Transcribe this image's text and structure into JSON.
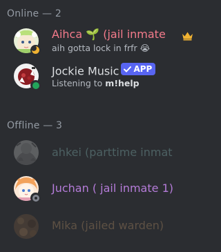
{
  "sections": {
    "online_header": "Online — 2",
    "offline_header": "Offline — 3"
  },
  "members": {
    "aihca": {
      "name": "Aihca 🌱 (jail inmate",
      "activity": "aih gotta lock in frfr 😭",
      "name_color": "#f47b8b",
      "status": "idle",
      "badge_icon": "crown-icon"
    },
    "jockie": {
      "name": "Jockie Music",
      "badge": "APP",
      "activity_prefix": "Listening to ",
      "activity_bold": "m!help",
      "name_color": "#dbdee1",
      "status": "online"
    },
    "ahkei": {
      "name": "ahkei (parttime inmat",
      "name_color": "#4d6163",
      "status": "offline"
    },
    "juchan": {
      "name": "Juchan ( jail inmate 1)",
      "name_color": "#b57cd9",
      "status": "offline"
    },
    "mika": {
      "name": "Mika (jailed warden)",
      "name_color": "#5e5144",
      "status": "offline"
    }
  },
  "colors": {
    "background": "#2b2d31",
    "header": "#949ba4",
    "online": "#23a55a",
    "idle": "#f0b232",
    "offline": "#80848e",
    "app_badge": "#5865f2"
  }
}
